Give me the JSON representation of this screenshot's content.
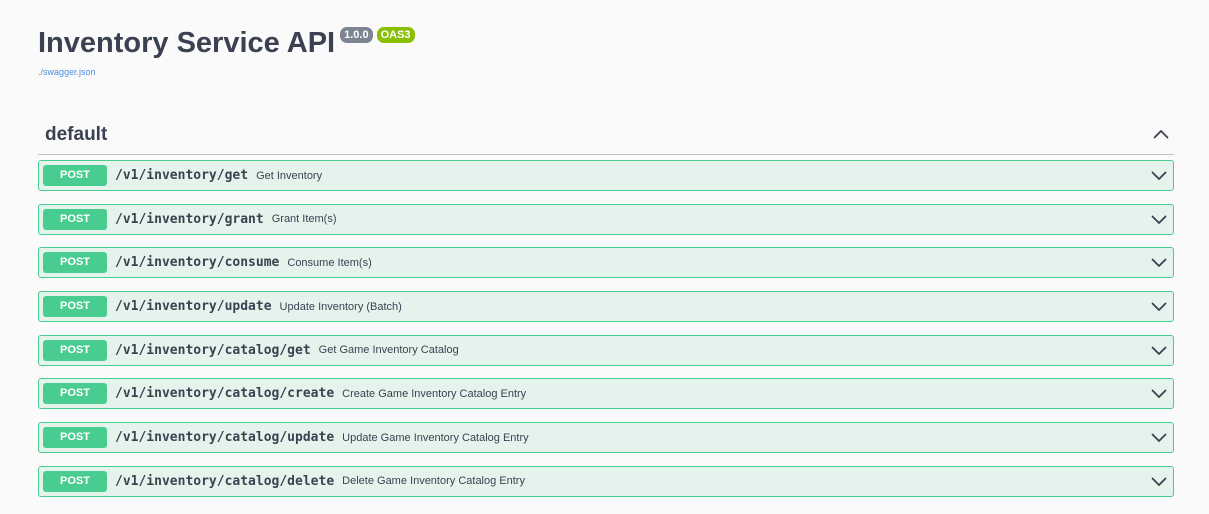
{
  "info": {
    "title": "Inventory Service API",
    "version": "1.0.0",
    "oas": "OAS3",
    "spec_link": "./swagger.json"
  },
  "section": {
    "title": "default",
    "toggle_icon": "chevron-up-icon",
    "operations": [
      {
        "method": "POST",
        "path": "/v1/inventory/get",
        "summary": "Get Inventory"
      },
      {
        "method": "POST",
        "path": "/v1/inventory/grant",
        "summary": "Grant Item(s)"
      },
      {
        "method": "POST",
        "path": "/v1/inventory/consume",
        "summary": "Consume Item(s)"
      },
      {
        "method": "POST",
        "path": "/v1/inventory/update",
        "summary": "Update Inventory (Batch)"
      },
      {
        "method": "POST",
        "path": "/v1/inventory/catalog/get",
        "summary": "Get Game Inventory Catalog"
      },
      {
        "method": "POST",
        "path": "/v1/inventory/catalog/create",
        "summary": "Create Game Inventory Catalog Entry"
      },
      {
        "method": "POST",
        "path": "/v1/inventory/catalog/update",
        "summary": "Update Game Inventory Catalog Entry"
      },
      {
        "method": "POST",
        "path": "/v1/inventory/catalog/delete",
        "summary": "Delete Game Inventory Catalog Entry"
      }
    ]
  },
  "colors": {
    "post": "#49cc90",
    "text": "#3b4151",
    "version_badge": "#7d8492",
    "oas_badge": "#89bf04",
    "link": "#4990e2"
  }
}
